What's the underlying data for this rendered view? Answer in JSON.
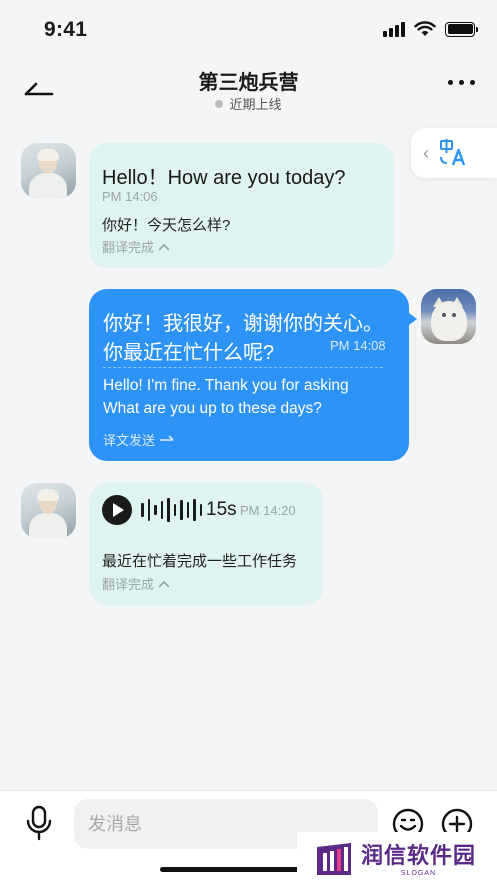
{
  "status_bar": {
    "time": "9:41"
  },
  "header": {
    "title": "第三炮兵营",
    "presence": "近期上线"
  },
  "translate_tab": {
    "icon": "translate-icon",
    "chevron": "‹"
  },
  "messages": [
    {
      "direction": "incoming",
      "text": "Hello！How are you today?",
      "time": "PM 14:06",
      "translation": "你好！今天怎么样?",
      "status": "翻译完成"
    },
    {
      "direction": "outgoing",
      "text_line1": "你好！我很好，谢谢你的关心。",
      "text_line2": "你最近在忙什么呢?",
      "time": "PM 14:08",
      "translation_line1": "Hello! I'm fine. Thank you for asking",
      "translation_line2": "What are you up to these days?",
      "status": "译文发送"
    },
    {
      "direction": "incoming",
      "type": "voice",
      "duration": "15s",
      "time": "PM 14:20",
      "translation": "最近在忙着完成一些工作任务",
      "status": "翻译完成"
    }
  ],
  "input_bar": {
    "placeholder": "发消息"
  },
  "watermark": {
    "title": "润信软件园",
    "slogan": "SLOGAN"
  },
  "colors": {
    "incoming_bubble": "#dff4f0",
    "outgoing_bubble": "#2e93f7",
    "background": "#f4f5f7",
    "watermark": "#5b2a86"
  }
}
